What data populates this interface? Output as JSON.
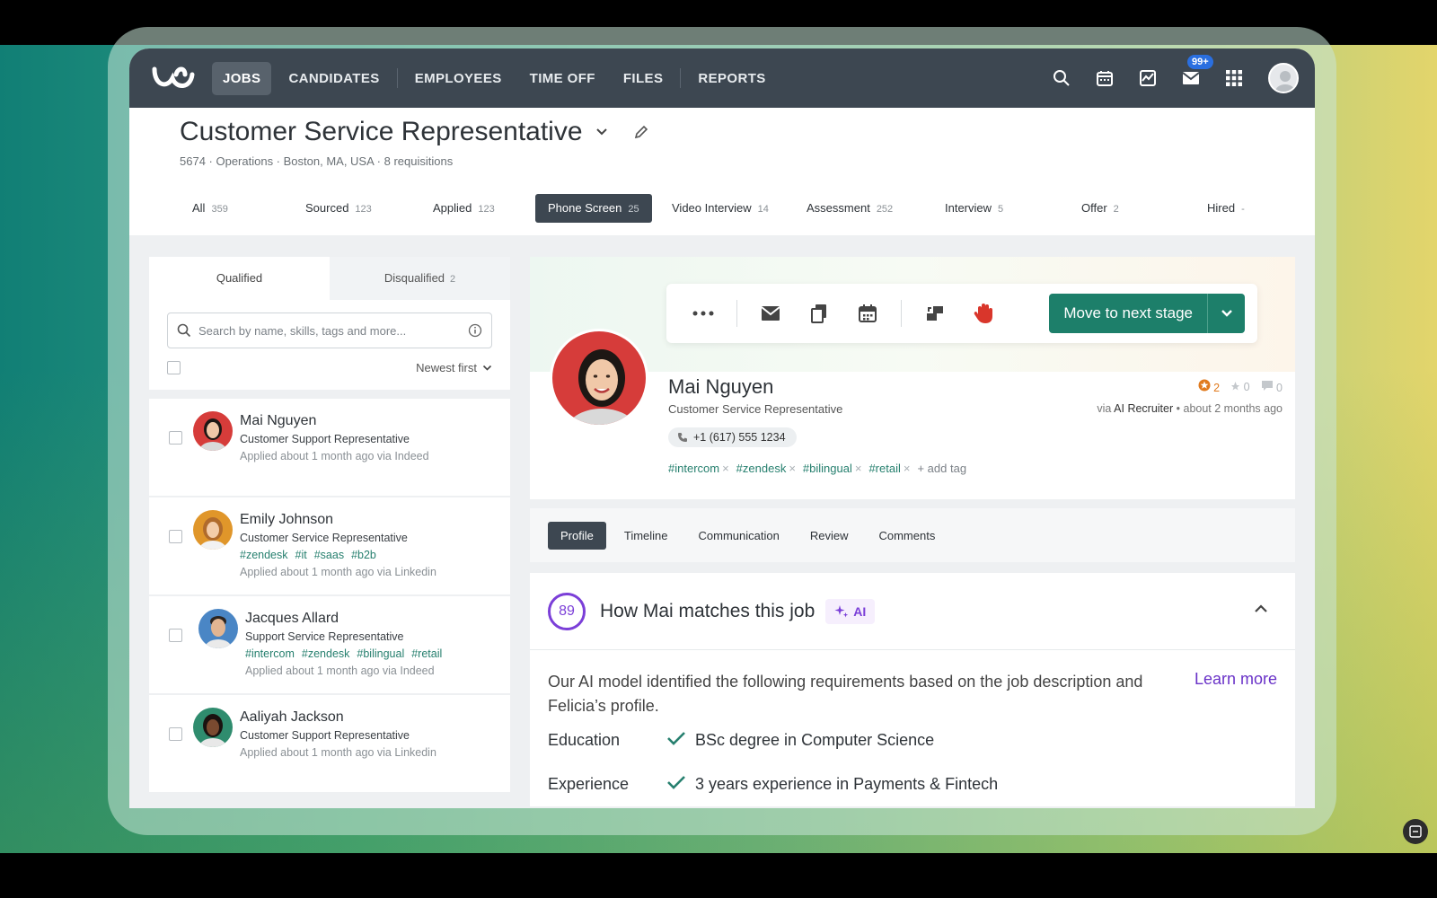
{
  "nav": {
    "items": [
      "JOBS",
      "CANDIDATES",
      "EMPLOYEES",
      "TIME OFF",
      "FILES",
      "REPORTS"
    ],
    "mail_badge": "99+"
  },
  "job": {
    "title": "Customer Service Representative",
    "meta": "5674 · Operations · Boston, MA, USA · 8 requisitions"
  },
  "stages": [
    {
      "label": "All",
      "count": "359"
    },
    {
      "label": "Sourced",
      "count": "123"
    },
    {
      "label": "Applied",
      "count": "123"
    },
    {
      "label": "Phone Screen",
      "count": "25"
    },
    {
      "label": "Video Interview",
      "count": "14"
    },
    {
      "label": "Assessment",
      "count": "252"
    },
    {
      "label": "Interview",
      "count": "5"
    },
    {
      "label": "Offer",
      "count": "2"
    },
    {
      "label": "Hired",
      "count": "-"
    }
  ],
  "left": {
    "tab_qualified": "Qualified",
    "tab_disqualified": "Disqualified",
    "disqualified_count": "2",
    "search_placeholder": "Search by name, skills, tags and more...",
    "sort": "Newest first"
  },
  "candidates": [
    {
      "name": "Mai Nguyen",
      "role": "Customer Support Representative",
      "tags": [],
      "applied": "Applied about 1 month ago via Indeed"
    },
    {
      "name": "Emily Johnson",
      "role": "Customer Service Representative",
      "tags": [
        "#zendesk",
        "#it",
        "#saas",
        "#b2b"
      ],
      "applied": "Applied about 1 month ago via Linkedin"
    },
    {
      "name": "Jacques Allard",
      "role": "Support Service Representative",
      "tags": [
        "#intercom",
        "#zendesk",
        "#bilingual",
        "#retail"
      ],
      "applied": "Applied about 1 month ago via Indeed"
    },
    {
      "name": "Aaliyah Jackson",
      "role": "Customer Support Representative",
      "tags": [],
      "applied": "Applied about 1 month ago via Linkedin"
    }
  ],
  "profile": {
    "move_label": "Move to next stage",
    "name": "Mai Nguyen",
    "role": "Customer Service Representative",
    "phone": "+1 (617) 555 1234",
    "tags": [
      "#intercom",
      "#zendesk",
      "#bilingual",
      "#retail"
    ],
    "add_tag": "+ add tag",
    "stars": "2",
    "thumbs": "0",
    "comments": "0",
    "via_prefix": "via",
    "via_source": "AI Recruiter",
    "via_time": "• about 2 months ago"
  },
  "sub_tabs": [
    "Profile",
    "Timeline",
    "Communication",
    "Review",
    "Comments"
  ],
  "match": {
    "score": "89",
    "title": "How Mai matches this job",
    "ai_label": "AI",
    "description": "Our AI model identified the following requirements based on the job description and Felicia’s profile.",
    "learn_more": "Learn more",
    "requirements": [
      {
        "label": "Education",
        "value": "BSc degree in Computer Science"
      },
      {
        "label": "Experience",
        "value": "3 years experience in Payments & Fintech"
      }
    ]
  },
  "colors": {
    "accent": "#1d7f6a",
    "nav": "#3d4751",
    "ai": "#7b3fd8",
    "tag": "#27806f"
  }
}
